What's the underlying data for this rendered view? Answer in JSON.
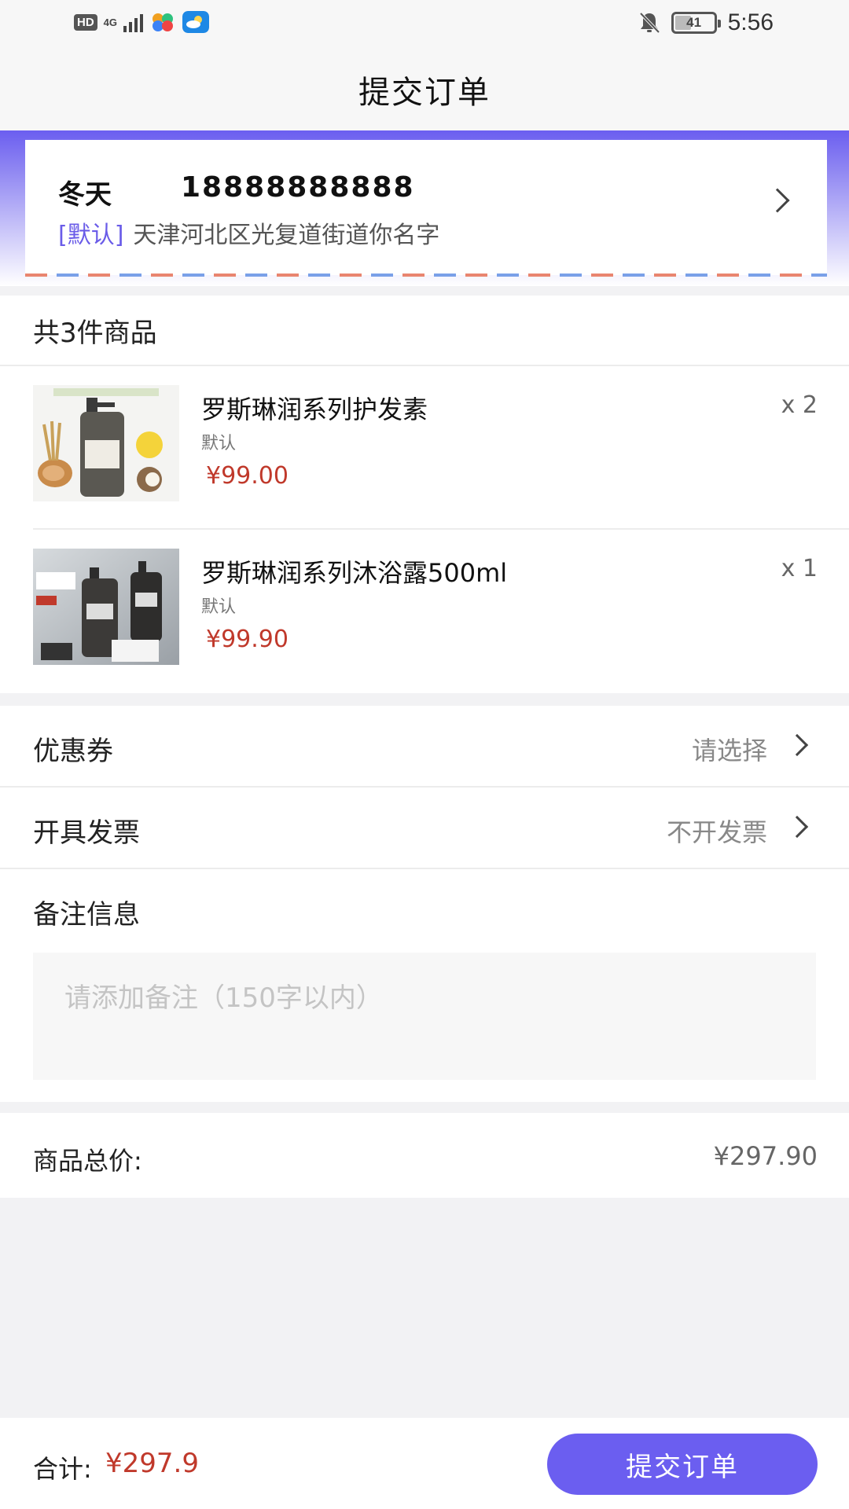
{
  "status_bar": {
    "hd": "HD",
    "network": "4G",
    "battery": "41",
    "time": "5:56",
    "icons": [
      "hd-icon",
      "signal-icon",
      "app-icon",
      "weather-icon",
      "mute-icon",
      "battery-icon"
    ]
  },
  "header": {
    "title": "提交订单"
  },
  "address": {
    "name": "冬天",
    "phone": "18888888888",
    "tag": "[默认]",
    "detail": "天津河北区光复道街道你名字"
  },
  "products": {
    "count_label": "共3件商品",
    "items": [
      {
        "name": "罗斯琳润系列护发素",
        "spec": "默认",
        "price": "¥99.00",
        "qty": "x 2",
        "image": "conditioner-bottle-image"
      },
      {
        "name": "罗斯琳润系列沐浴露500ml",
        "spec": "默认",
        "price": "¥99.90",
        "qty": "x 1",
        "image": "shower-gel-bottle-image"
      }
    ]
  },
  "coupon": {
    "label": "优惠券",
    "value": "请选择"
  },
  "invoice": {
    "label": "开具发票",
    "value": "不开发票"
  },
  "remark": {
    "label": "备注信息",
    "placeholder": "请添加备注（150字以内）"
  },
  "total": {
    "label": "商品总价:",
    "value": "¥297.90"
  },
  "footer": {
    "sum_label": "合计:",
    "sum_value": "¥297.9",
    "submit_label": "提交订单"
  },
  "colors": {
    "accent": "#6b5ef0",
    "price": "#c0392b"
  }
}
